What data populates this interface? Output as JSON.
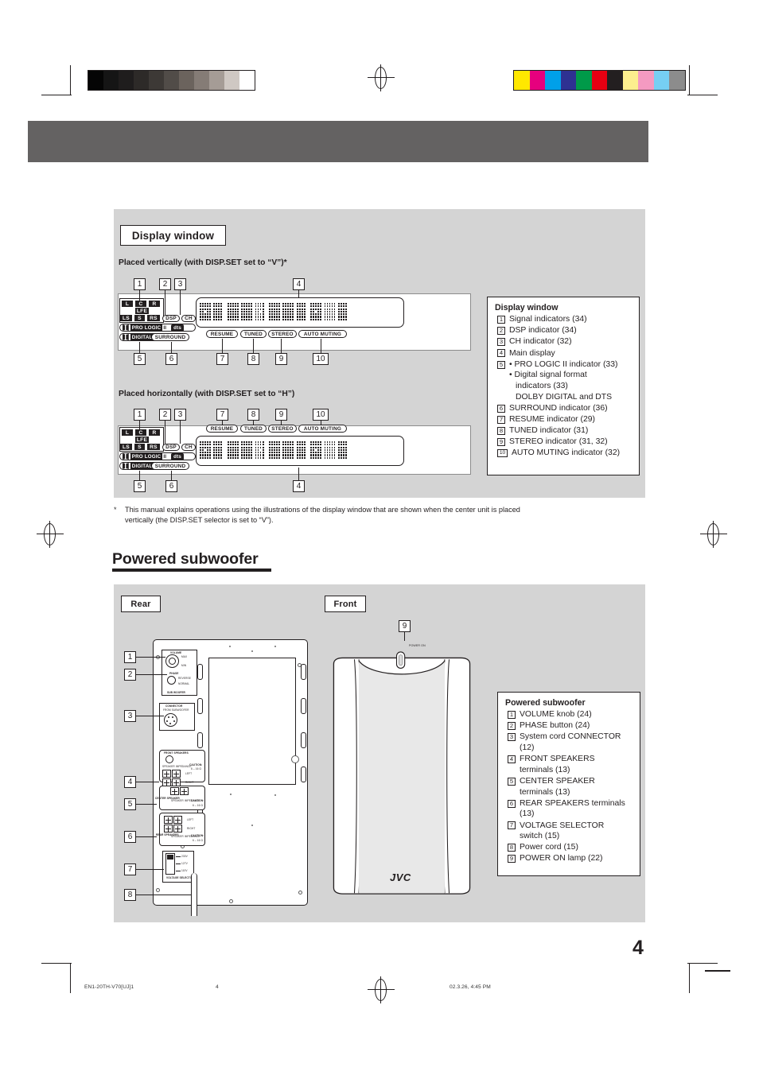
{
  "page": {
    "number": "4",
    "footer_left": "EN1-20TH-V70[UJ]1",
    "footer_page": "4",
    "footer_right": "02.3.26, 4:45 PM"
  },
  "display_section": {
    "label": "Display window",
    "vertical_subhead": "Placed vertically (with DISP.SET set to “V”)*",
    "horizontal_subhead": "Placed horizontally (with DISP.SET set to “H”)",
    "footnote_marker": "*",
    "footnote_line1": "This manual explains operations using the illustrations of the display window that are shown when the center unit is placed",
    "footnote_line2": "vertically (the DISP.SET selector is set to “V”).",
    "callouts_top_vertical": [
      "1",
      "2",
      "3",
      "4"
    ],
    "callouts_bottom_vertical": [
      "5",
      "6",
      "7",
      "8",
      "9",
      "10"
    ],
    "callouts_top_horizontal": [
      "1",
      "2",
      "3",
      "7",
      "8",
      "9",
      "10"
    ],
    "callouts_bottom_horizontal": [
      "5",
      "6",
      "4"
    ],
    "indicators": {
      "signal_row1": [
        "L",
        "C",
        "R"
      ],
      "signal_lfe": "LFE",
      "signal_row2": [
        "LS",
        "S",
        "RS"
      ],
      "dsp": "DSP",
      "ch": "CH",
      "pro_logic": "PRO LOGIC",
      "pro_logic_suffix": "II",
      "dts": "dts",
      "digital": "DIGITAL",
      "surround": "SURROUND",
      "resume": "RESUME",
      "tuned": "TUNED",
      "stereo": "STEREO",
      "auto_muting": "AUTO  MUTING"
    }
  },
  "display_key": {
    "title": "Display window",
    "items": [
      {
        "num": "1",
        "text": "Signal indicators (34)"
      },
      {
        "num": "2",
        "text": "DSP indicator (34)"
      },
      {
        "num": "3",
        "text": "CH indicator (32)"
      },
      {
        "num": "4",
        "text": "Main display"
      },
      {
        "num": "5",
        "bullets": [
          "PRO LOGIC II indicator (33)",
          "Digital signal format"
        ],
        "cont": "indicators (33)",
        "cont2": "DOLBY DIGITAL and DTS"
      },
      {
        "num": "6",
        "text": "SURROUND indicator (36)"
      },
      {
        "num": "7",
        "text": "RESUME indicator (29)"
      },
      {
        "num": "8",
        "text": "TUNED indicator (31)"
      },
      {
        "num": "9",
        "text": "STEREO indicator (31, 32)"
      },
      {
        "num": "10",
        "text": "AUTO MUTING indicator (32)"
      }
    ]
  },
  "subwoofer_section": {
    "heading": "Powered subwoofer",
    "rear_label": "Rear",
    "front_label": "Front",
    "brand": "JVC",
    "callouts_rear": [
      "1",
      "2",
      "3",
      "4",
      "5",
      "6",
      "7",
      "8"
    ],
    "callout_front": "9",
    "panel_text": {
      "volume": "VOLUME",
      "volume_min": "MIN",
      "volume_max": "MAX",
      "phase": "PHASE",
      "phase_normal": "NORMAL",
      "phase_reverse": "REVERSE",
      "subwoofer": "SUB WOOFER",
      "connector": "CONNECTOR",
      "connector_sub": "FROM SUBWOOFER",
      "front_speakers": "FRONT SPEAKERS",
      "center_speaker": "CENTER SPEAKER",
      "rear_speakers": "REAR SPEAKERS",
      "left": "LEFT",
      "right": "RIGHT",
      "caution": "CAUTION:",
      "impedance": "SPEAKER IMPEDANCE",
      "ohm_range": "6 – 16 Ω",
      "voltage_selector": "VOLTAGE SELECTOR",
      "v230": "230V",
      "v127": "127V",
      "v110": "110V",
      "power_on": "POWER ON"
    }
  },
  "subwoofer_key": {
    "title": "Powered subwoofer",
    "items": [
      {
        "num": "1",
        "text": "VOLUME knob (24)"
      },
      {
        "num": "2",
        "text": "PHASE button (24)"
      },
      {
        "num": "3",
        "text": "System cord CONNECTOR",
        "cont": "(12)"
      },
      {
        "num": "4",
        "text": "FRONT SPEAKERS",
        "cont": "terminals (13)"
      },
      {
        "num": "5",
        "text": "CENTER SPEAKER",
        "cont": "terminals (13)"
      },
      {
        "num": "6",
        "text": "REAR SPEAKERS terminals",
        "cont": "(13)"
      },
      {
        "num": "7",
        "text": "VOLTAGE SELECTOR",
        "cont": "switch (15)"
      },
      {
        "num": "8",
        "text": "Power cord (15)"
      },
      {
        "num": "9",
        "text": "POWER ON lamp (22)"
      }
    ]
  },
  "print_marks": {
    "gray_ramp": [
      "#050505",
      "#151515",
      "#1f1d1d",
      "#2d2a28",
      "#3d3936",
      "#514c48",
      "#6b635d",
      "#857c76",
      "#a59c96",
      "#cfc8c3",
      "#ffffff"
    ],
    "color_bars": [
      "#ffe800",
      "#e6007e",
      "#00a0e9",
      "#2e3192",
      "#009a49",
      "#e60012",
      "#231f20",
      "#fcee8e",
      "#f49ac1",
      "#76cff3",
      "#8c8c8c"
    ],
    "header_band_color": "#646262",
    "panel_color": "#d4d4d4"
  }
}
